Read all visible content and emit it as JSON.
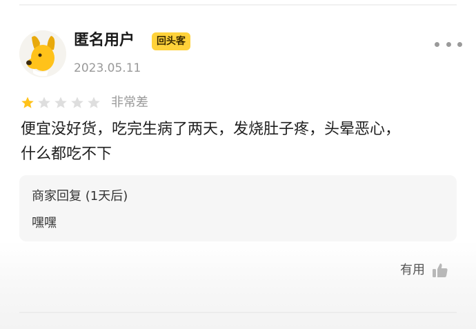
{
  "review": {
    "user": {
      "name": "匿名用户",
      "badge": "回头客",
      "date": "2023.05.11",
      "avatar_icon": "yellow-dog-avatar"
    },
    "more_icon": "more-dots-icon",
    "rating": {
      "value": 1,
      "max": 5,
      "label": "非常差",
      "filled_color": "#ffc21a",
      "empty_color": "#dedede"
    },
    "text_line1": "便宜没好货，吃完生病了两天，发烧肚子疼，头晕恶心，",
    "text_line2": "什么都吃不下",
    "merchant_reply": {
      "title": "商家回复 (1天后)",
      "text": "嘿嘿"
    },
    "useful": {
      "label": "有用",
      "icon": "thumbs-up-icon"
    }
  },
  "colors": {
    "badge_bg": "#ffd23a",
    "accent_yellow": "#ffc21a"
  }
}
